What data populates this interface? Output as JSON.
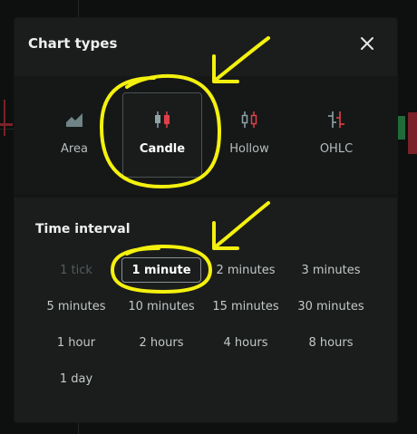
{
  "dialog": {
    "title": "Chart types",
    "close_icon": "close-icon"
  },
  "chart_types": [
    {
      "label": "Area",
      "icon": "area-chart-icon",
      "selected": false
    },
    {
      "label": "Candle",
      "icon": "candle-chart-icon",
      "selected": true
    },
    {
      "label": "Hollow",
      "icon": "hollow-candle-icon",
      "selected": false
    },
    {
      "label": "OHLC",
      "icon": "ohlc-chart-icon",
      "selected": false
    }
  ],
  "time_interval": {
    "title": "Time interval",
    "options": [
      {
        "label": "1 tick",
        "disabled": true
      },
      {
        "label": "1 minute",
        "selected": true
      },
      {
        "label": "2 minutes"
      },
      {
        "label": "3 minutes"
      },
      {
        "label": "5 minutes"
      },
      {
        "label": "10 minutes"
      },
      {
        "label": "15 minutes"
      },
      {
        "label": "30 minutes"
      },
      {
        "label": "1 hour"
      },
      {
        "label": "2 hours"
      },
      {
        "label": "4 hours"
      },
      {
        "label": "8 hours"
      },
      {
        "label": "1 day"
      }
    ]
  },
  "colors": {
    "dialog_bg": "#1b1d1d",
    "panel_bg": "#161818",
    "candle_red": "#e0404a",
    "icon_gray": "#8fa3a6",
    "annotation_yellow": "#f4f10e"
  }
}
